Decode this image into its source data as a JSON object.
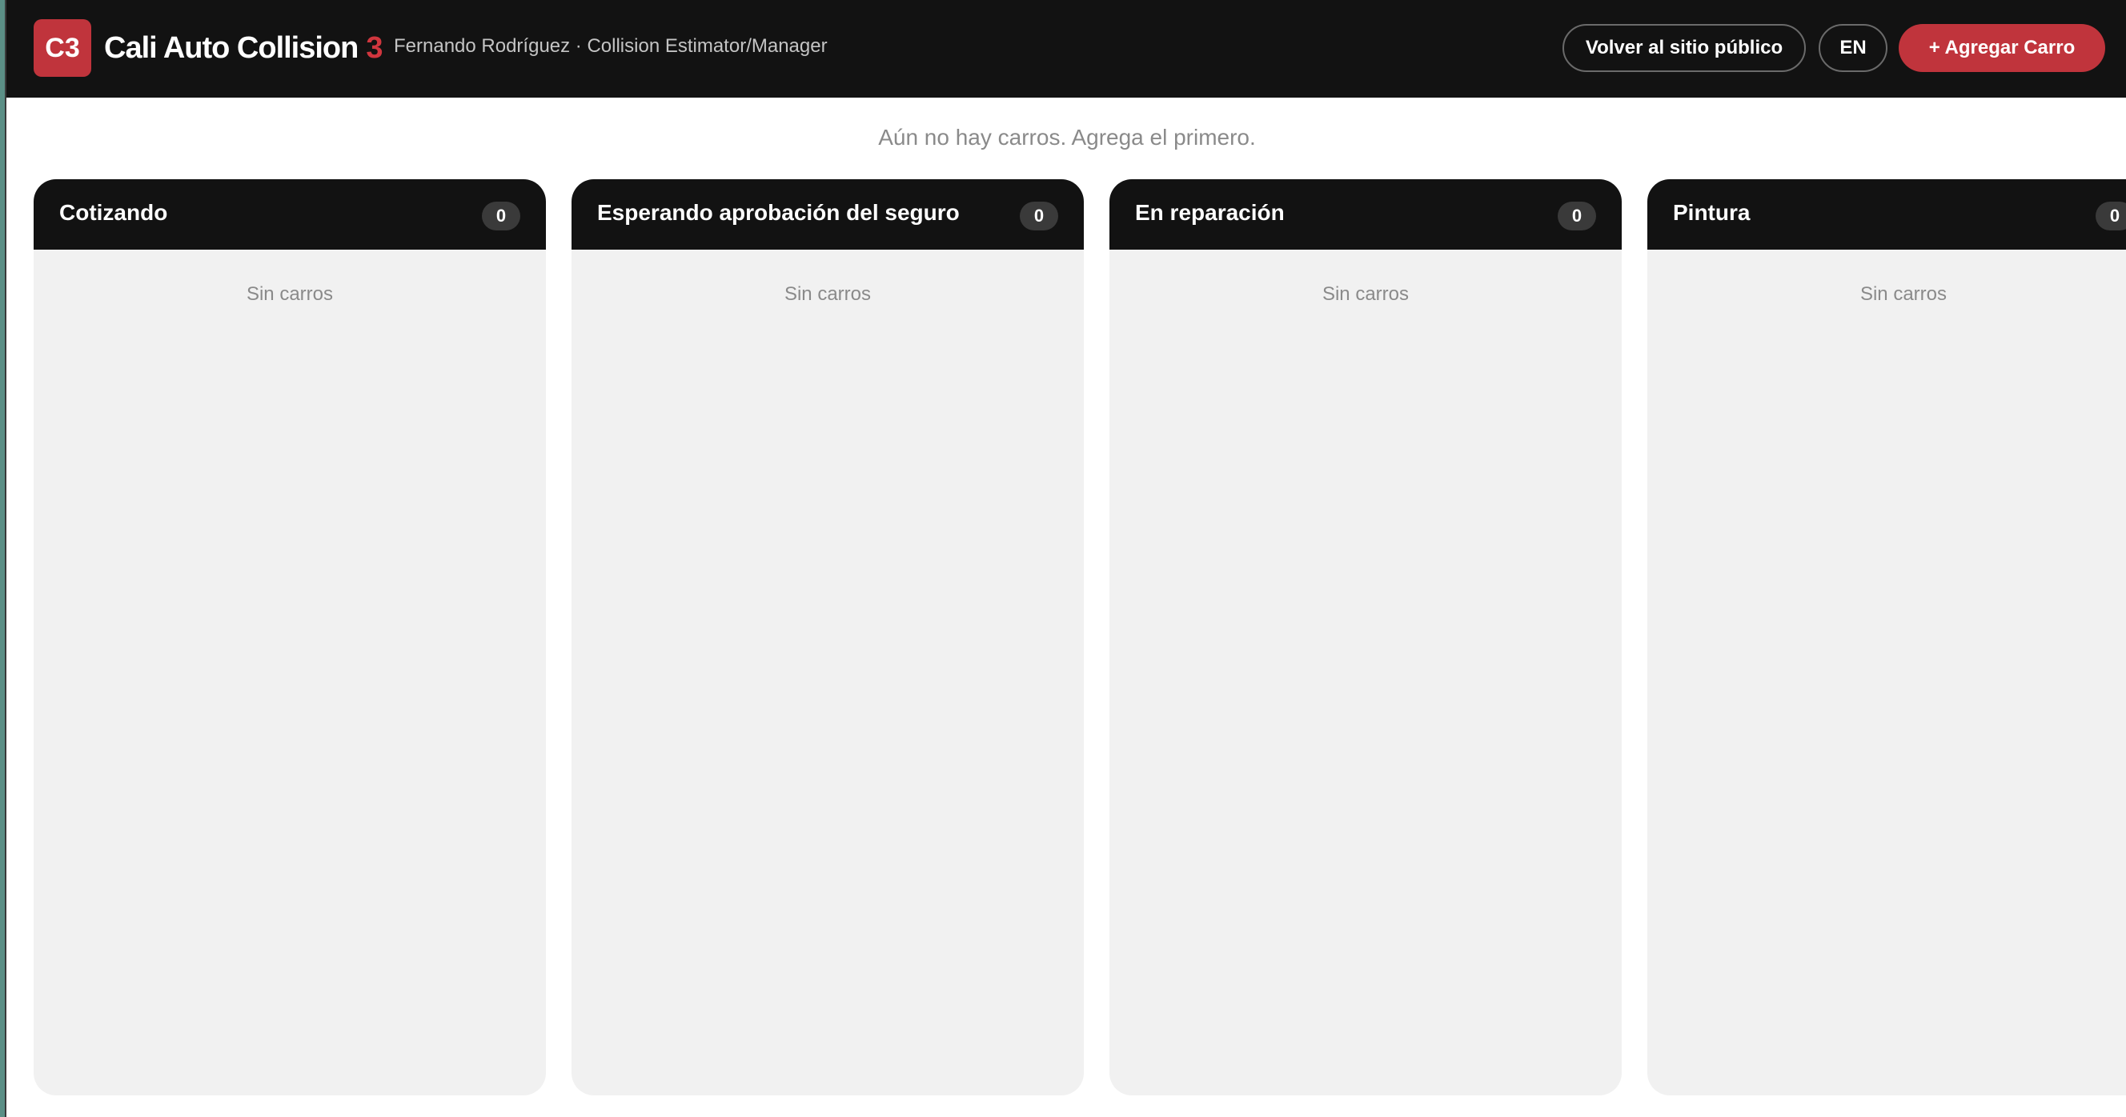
{
  "header": {
    "logo_text": "C3",
    "brand_name": "Cali Auto Collision",
    "brand_accent": "3",
    "user_info": "Fernando Rodríguez · Collision Estimator/Manager",
    "public_site_button": "Volver al sitio público",
    "language_button": "EN",
    "add_car_button": "+ Agregar Carro"
  },
  "board": {
    "empty_message": "Aún no hay carros. Agrega el primero.",
    "columns": [
      {
        "title": "Cotizando",
        "count": "0",
        "empty_text": "Sin carros"
      },
      {
        "title": "Esperando aprobación del seguro",
        "count": "0",
        "empty_text": "Sin carros"
      },
      {
        "title": "En reparación",
        "count": "0",
        "empty_text": "Sin carros"
      },
      {
        "title": "Pintura",
        "count": "0",
        "empty_text": "Sin carros"
      }
    ]
  },
  "colors": {
    "brand_red": "#c0343c",
    "header_bg": "#121212",
    "column_bg": "#f1f1f1"
  }
}
